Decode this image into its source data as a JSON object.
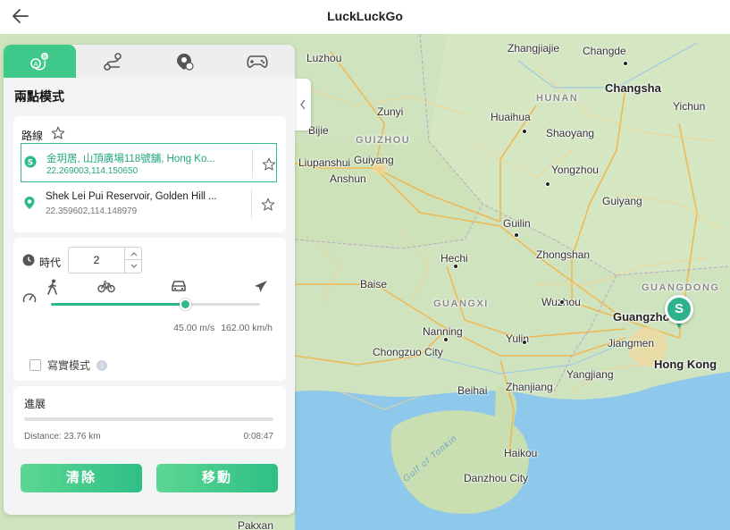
{
  "app": {
    "title": "LuckLuckGo",
    "back_icon": "back-arrow-icon"
  },
  "tabs": [
    {
      "name": "two-point-mode",
      "icon": "two-point-route-icon",
      "active": true
    },
    {
      "name": "multi-point-mode",
      "icon": "multi-point-route-icon",
      "active": false
    },
    {
      "name": "teleport-mode",
      "icon": "location-pin-icon",
      "active": false
    },
    {
      "name": "joystick-mode",
      "icon": "gamepad-icon",
      "active": false
    }
  ],
  "panel": {
    "title": "兩點模式"
  },
  "route": {
    "label": "路線",
    "start": {
      "name": "金玥居, 山頂廣場118號舖, Hong Ko...",
      "coord": "22.269003,114.150650",
      "pin_letter": "S"
    },
    "end": {
      "name": "Shek Lei Pui Reservoir, Golden Hill ...",
      "coord": "22.359602,114.148979"
    }
  },
  "speed": {
    "time_label": "時代",
    "multiplier": "2",
    "modes": [
      "walk-icon",
      "bike-icon",
      "car-icon",
      "plane-icon"
    ],
    "slider_fraction": 0.64,
    "ms": "45.00 m/s",
    "kmh": "162.00 km/h"
  },
  "realistic": {
    "label": "寫實模式",
    "checked": false
  },
  "progress": {
    "label": "進展",
    "fraction": 0.0,
    "distance": "Distance: 23.76 km",
    "time": "0:08:47"
  },
  "actions": {
    "clear": "清除",
    "move": "移動"
  },
  "colors": {
    "accent": "#2eb98a",
    "marker": "#2eb28c"
  },
  "map": {
    "marker_letter": "S",
    "labels": {
      "zhangjiajie": "Zhangjiajie",
      "changde": "Changde",
      "luzhou": "Luzhou",
      "hunan": "HUNAN",
      "changsha": "Changsha",
      "zunyi": "Zunyi",
      "huaihua": "Huaihua",
      "yichun": "Yichun",
      "bijie": "Bijie",
      "guizhou": "GUIZHOU",
      "shaoyang": "Shaoyang",
      "liupanshui": "Liupanshui",
      "guiyang": "Guiyang",
      "anshun": "Anshun",
      "yongzhou": "Yongzhou",
      "guiyang2": "Guiyang",
      "guilin": "Guilin",
      "zhongshan": "Zhongshan",
      "hechi": "Hechi",
      "baise": "Baise",
      "guangdong": "GUANGDONG",
      "guangxi": "GUANGXI",
      "wuzhou": "Wuzhou",
      "guangzhou": "Guangzhou",
      "nanning": "Nanning",
      "yulin": "Yulin",
      "jiangmen": "Jiangmen",
      "chongzuo": "Chongzuo City",
      "hongkong": "Hong Kong",
      "yangjiang": "Yangjiang",
      "beihai": "Beihai",
      "zhanjiang": "Zhanjiang",
      "gulf": "Gulf of Tonkin",
      "haikou": "Haikou",
      "danzhou": "Danzhou City",
      "pakxan": "Pakxan"
    }
  }
}
